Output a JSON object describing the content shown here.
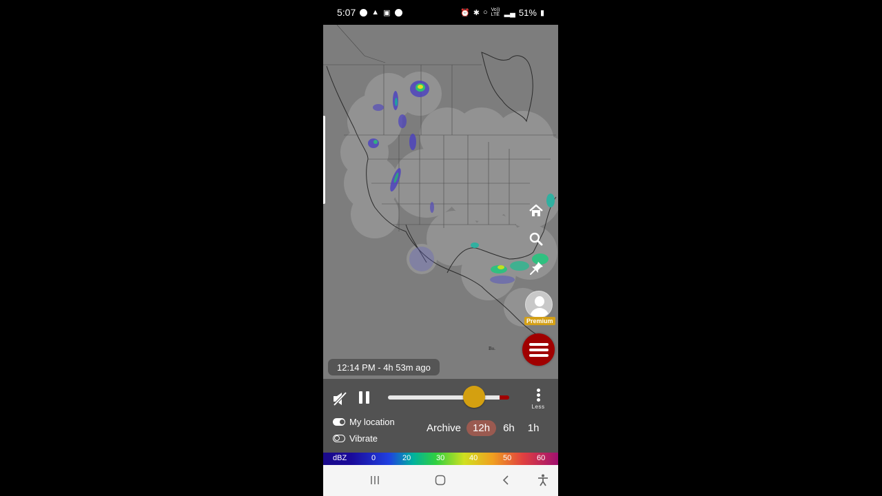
{
  "status_bar": {
    "time": "5:07",
    "left_icons": [
      "messenger-icon",
      "snapchat-icon",
      "screenshot-icon",
      "spotify-icon"
    ],
    "right_icons": [
      "alarm-icon",
      "bluetooth-icon",
      "wifi-icon",
      "volte-lte-icon",
      "signal-icon"
    ],
    "volte_label": "Vo)) LTE",
    "battery": "51%"
  },
  "map": {
    "timestamp": "12:14 PM - 4h 53m ago",
    "land_label": "Bo.",
    "side_buttons": [
      "home-icon",
      "search-icon",
      "pin-icon"
    ],
    "premium_label": "Premium",
    "menu_icon": "hamburger-menu-icon",
    "colors": {
      "map_bg": "#7d7d7d",
      "land": "#8a8a8a",
      "coverage": "#a0a0a0",
      "menu_fab": "#a00000"
    }
  },
  "controls": {
    "mute_icon": "mute-icon",
    "pause_icon": "pause-icon",
    "slider_progress": 0.72,
    "less_label": "Less",
    "toggles": [
      {
        "label": "My location",
        "on": true
      },
      {
        "label": "Vibrate",
        "on": false
      }
    ],
    "archive_label": "Archive",
    "ranges": [
      {
        "label": "12h",
        "active": true
      },
      {
        "label": "6h",
        "active": false
      },
      {
        "label": "1h",
        "active": false
      }
    ],
    "colors": {
      "panel": "#525252",
      "thumb": "#d4a010",
      "active_range": "#9a5a50"
    }
  },
  "legend": {
    "unit": "dBZ",
    "ticks": [
      "0",
      "20",
      "30",
      "40",
      "50",
      "60"
    ]
  },
  "nav_bar": {
    "buttons": [
      "recents-icon",
      "home-button-icon",
      "back-icon",
      "accessibility-icon"
    ]
  }
}
